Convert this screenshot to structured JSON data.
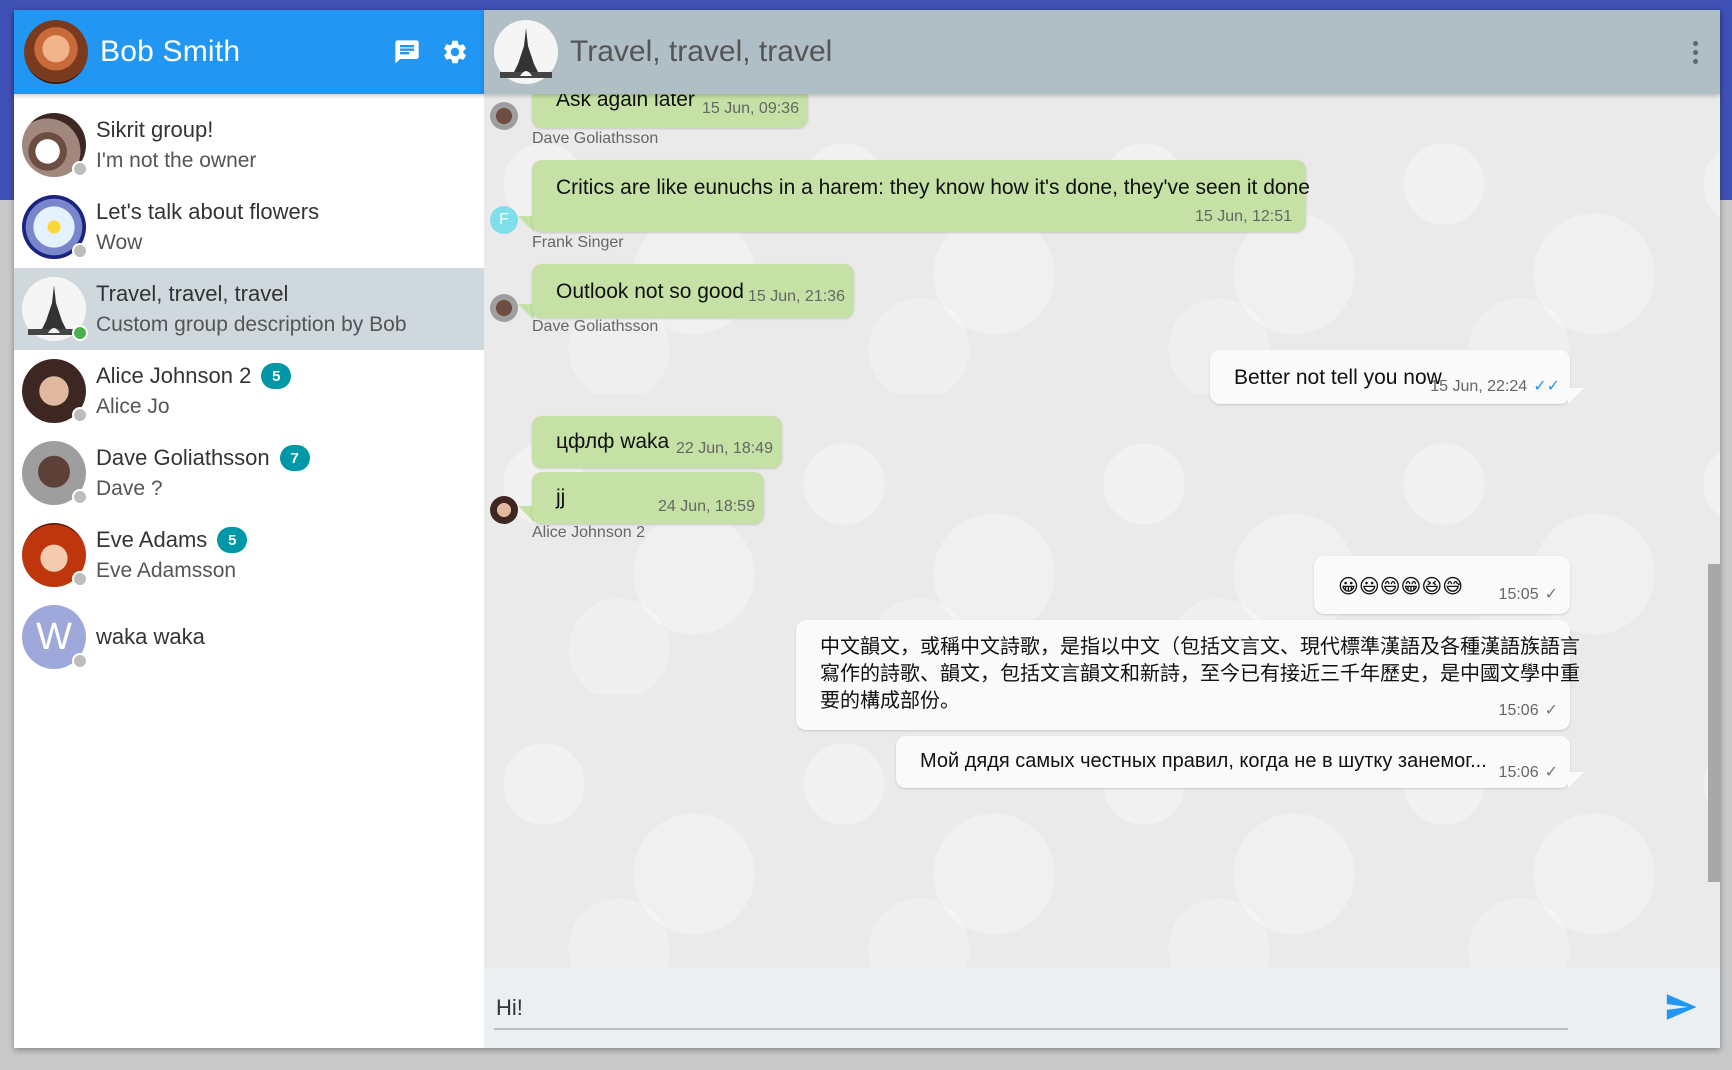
{
  "me": {
    "name": "Bob Smith"
  },
  "icons": {
    "new_chat": "chat-icon",
    "settings": "gear-icon",
    "menu": "more-vert-icon",
    "send": "send-icon"
  },
  "colors": {
    "sidebar_header": "#2196f3",
    "main_header": "#b0bec5",
    "badge": "#0097a7",
    "incoming": "#c5e1a5",
    "outgoing": "#fafafa",
    "page_band": "#3f51b5"
  },
  "contacts": [
    {
      "name": "Sikrit group!",
      "sub": "I'm not the owner",
      "badge": "",
      "online": false
    },
    {
      "name": "Let's talk about flowers",
      "sub": "Wow",
      "badge": "",
      "online": false
    },
    {
      "name": "Travel, travel, travel",
      "sub": "Custom group description by Bob",
      "badge": "",
      "online": true
    },
    {
      "name": "Alice Johnson 2",
      "sub": "Alice Jo",
      "badge": "5",
      "online": false
    },
    {
      "name": "Dave Goliathsson",
      "sub": "Dave ?",
      "badge": "7",
      "online": false
    },
    {
      "name": "Eve Adams",
      "sub": "Eve Adamsson",
      "badge": "5",
      "online": false
    },
    {
      "name": "waka waka",
      "sub": "",
      "badge": "",
      "online": false,
      "avatar_letter": "W"
    }
  ],
  "chat": {
    "title": "Travel, travel, travel",
    "messages": [
      {
        "text": "Ask again later",
        "time": "15 Jun, 09:36",
        "sender": "Dave Goliathsson"
      },
      {
        "text": "Critics are like eunuchs in a harem: they know how it's done, they've seen it done",
        "time": "15 Jun, 12:51",
        "sender": "Frank Singer",
        "sender_letter": "F"
      },
      {
        "text": "Outlook not so good",
        "time": "15 Jun, 21:36",
        "sender": "Dave Goliathsson"
      },
      {
        "text": "Better not tell you now",
        "time": "15 Jun, 22:24",
        "status": "read"
      },
      {
        "text": "цфлф waka",
        "time": "22 Jun, 18:49"
      },
      {
        "text": "jj",
        "time": "24 Jun, 18:59",
        "sender": "Alice Johnson 2"
      },
      {
        "text": "😀😃😄😁😆😅",
        "time": "15:05",
        "status": "sent"
      },
      {
        "lines": [
          "中文韻文，或稱中文詩歌，是指以中文（包括文言文、現代標準漢語及各種漢語族語言",
          "寫作的詩歌、韻文，包括文言韻文和新詩，至今已有接近三千年歷史，是中國文學中重",
          "要的構成部份。"
        ],
        "time": "15:06",
        "status": "sent"
      },
      {
        "text": "Мой дядя самых честных правил, когда не в шутку занемог...",
        "time": "15:06",
        "status": "sent"
      }
    ]
  },
  "composer": {
    "value": "Hi!"
  }
}
